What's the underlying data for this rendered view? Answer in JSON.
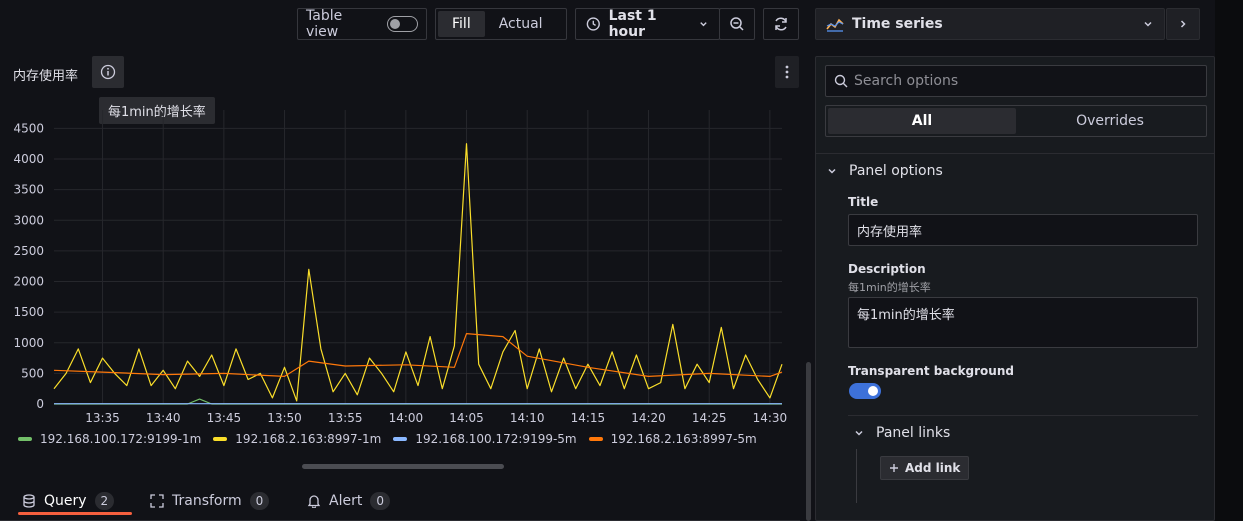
{
  "toolbar": {
    "table_view_label": "Table view",
    "fill_label": "Fill",
    "actual_label": "Actual",
    "time_range": "Last 1 hour"
  },
  "panel": {
    "title": "内存使用率",
    "tooltip": "每1min的增长率"
  },
  "chart_data": {
    "type": "line",
    "x_ticks": [
      "13:35",
      "13:40",
      "13:45",
      "13:50",
      "13:55",
      "14:00",
      "14:05",
      "14:10",
      "14:15",
      "14:20",
      "14:25",
      "14:30"
    ],
    "y_ticks": [
      0,
      500,
      1000,
      1500,
      2000,
      2500,
      3000,
      3500,
      4000,
      4500
    ],
    "ylim": [
      0,
      4800
    ],
    "series": [
      {
        "name": "192.168.100.172:9199-1m",
        "color": "#73bf69",
        "x": [
          "13:31",
          "13:42",
          "13:43",
          "13:44",
          "13:47",
          "14:31"
        ],
        "y": [
          0,
          0,
          80,
          0,
          0,
          0
        ]
      },
      {
        "name": "192.168.2.163:8997-1m",
        "color": "#fade2a",
        "x": [
          "13:31",
          "13:32",
          "13:33",
          "13:34",
          "13:35",
          "13:36",
          "13:37",
          "13:38",
          "13:39",
          "13:40",
          "13:41",
          "13:42",
          "13:43",
          "13:44",
          "13:45",
          "13:46",
          "13:47",
          "13:48",
          "13:49",
          "13:50",
          "13:51",
          "13:52",
          "13:53",
          "13:54",
          "13:55",
          "13:56",
          "13:57",
          "13:58",
          "13:59",
          "14:00",
          "14:01",
          "14:02",
          "14:03",
          "14:04",
          "14:05",
          "14:06",
          "14:07",
          "14:08",
          "14:09",
          "14:10",
          "14:11",
          "14:12",
          "14:13",
          "14:14",
          "14:15",
          "14:16",
          "14:17",
          "14:18",
          "14:19",
          "14:20",
          "14:21",
          "14:22",
          "14:23",
          "14:24",
          "14:25",
          "14:26",
          "14:27",
          "14:28",
          "14:29",
          "14:30",
          "14:31"
        ],
        "y": [
          250,
          500,
          900,
          350,
          750,
          500,
          300,
          900,
          300,
          550,
          250,
          700,
          450,
          800,
          300,
          900,
          400,
          500,
          100,
          600,
          50,
          2200,
          900,
          200,
          500,
          150,
          750,
          500,
          200,
          850,
          300,
          1100,
          250,
          950,
          4250,
          650,
          250,
          850,
          1200,
          250,
          900,
          200,
          750,
          250,
          650,
          300,
          850,
          250,
          800,
          250,
          350,
          1300,
          250,
          650,
          350,
          1250,
          250,
          800,
          400,
          100,
          650
        ]
      },
      {
        "name": "192.168.100.172:9199-5m",
        "color": "#8ab8ff",
        "x": [
          "13:31",
          "14:31"
        ],
        "y": [
          5,
          5
        ]
      },
      {
        "name": "192.168.2.163:8997-5m",
        "color": "#ff780a",
        "x": [
          "13:31",
          "13:35",
          "13:40",
          "13:45",
          "13:50",
          "13:52",
          "13:55",
          "14:00",
          "14:04",
          "14:05",
          "14:08",
          "14:10",
          "14:15",
          "14:20",
          "14:25",
          "14:30",
          "14:31"
        ],
        "y": [
          550,
          520,
          480,
          500,
          450,
          700,
          620,
          640,
          600,
          1150,
          1100,
          780,
          600,
          450,
          500,
          450,
          520
        ]
      }
    ]
  },
  "bottom_tabs": [
    {
      "label": "Query",
      "count": "2"
    },
    {
      "label": "Transform",
      "count": "0"
    },
    {
      "label": "Alert",
      "count": "0"
    }
  ],
  "options": {
    "viz_name": "Time series",
    "search_placeholder": "Search options",
    "tab_all": "All",
    "tab_overrides": "Overrides",
    "section_title": "Panel options",
    "title_label": "Title",
    "title_value": "内存使用率",
    "description_label": "Description",
    "description_hint": "每1min的增长率",
    "description_value": "每1min的增长率",
    "transparent_label": "Transparent background",
    "links_title": "Panel links",
    "add_link_label": "Add link"
  }
}
